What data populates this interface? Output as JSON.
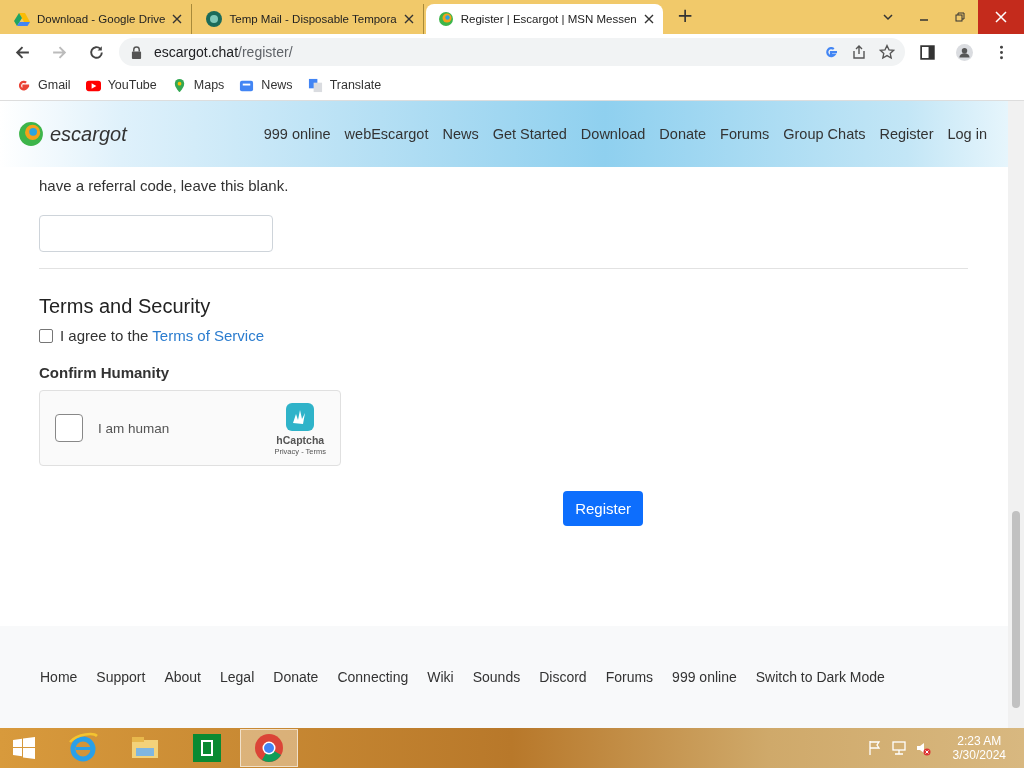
{
  "browser": {
    "tabs": [
      {
        "title": "Download - Google Drive",
        "selected": false
      },
      {
        "title": "Temp Mail - Disposable Tempora",
        "selected": false
      },
      {
        "title": "Register | Escargot | MSN Messen",
        "selected": true
      }
    ],
    "new_tab": "+",
    "address": {
      "host": "escargot.chat",
      "path": "/register/"
    },
    "bookmarks": [
      "Gmail",
      "YouTube",
      "Maps",
      "News",
      "Translate"
    ]
  },
  "site": {
    "logo": "escargot",
    "nav": [
      "999 online",
      "webEscargot",
      "News",
      "Get Started",
      "Download",
      "Donate",
      "Forums",
      "Group Chats",
      "Register",
      "Log in"
    ]
  },
  "form": {
    "referral_hint": "have a referral code, leave this blank.",
    "terms_heading": "Terms and Security",
    "agree": {
      "text": "I agree to the ",
      "link": "Terms of Service",
      "checked": false
    },
    "humanity_heading": "Confirm Humanity",
    "captcha": {
      "label": "I am human",
      "checked": false,
      "brand": "hCaptcha",
      "privacy": "Privacy",
      "sep": " - ",
      "terms": "Terms"
    },
    "submit": "Register"
  },
  "footer": [
    "Home",
    "Support",
    "About",
    "Legal",
    "Donate",
    "Connecting",
    "Wiki",
    "Sounds",
    "Discord",
    "Forums",
    "999 online",
    "Switch to Dark Mode"
  ],
  "taskbar": {
    "apps": [
      {
        "selected": false
      },
      {
        "selected": false
      },
      {
        "selected": false
      },
      {
        "selected": true
      }
    ],
    "time": "2:23 AM",
    "date": "3/30/2024"
  }
}
